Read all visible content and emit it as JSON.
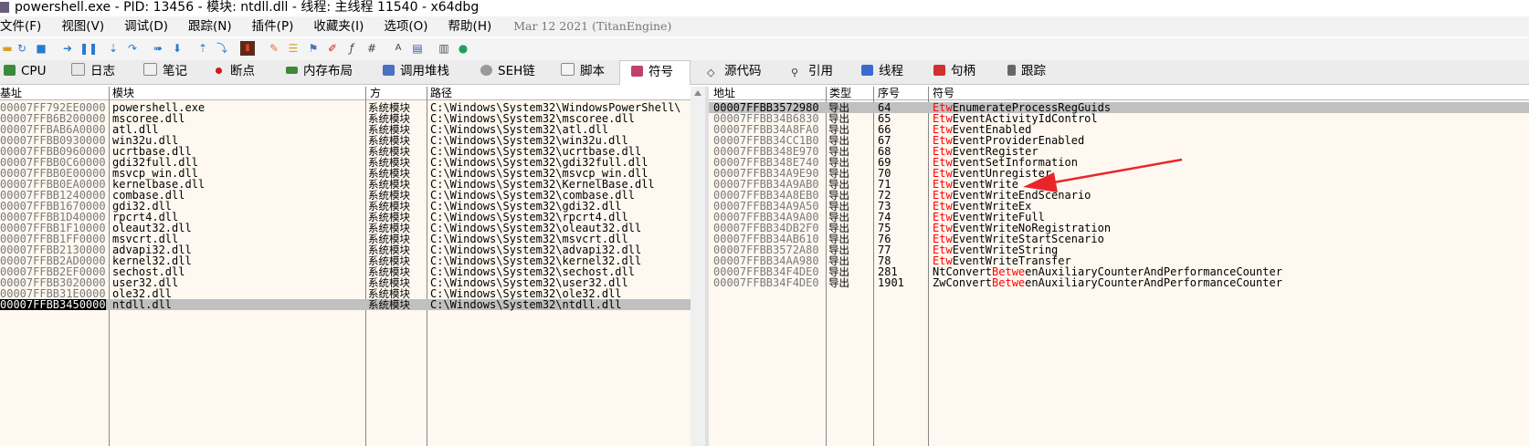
{
  "title": "powershell.exe - PID: 13456 - 模块: ntdll.dll - 线程: 主线程 11540 - x64dbg",
  "menu": [
    "文件(F)",
    "视图(V)",
    "调试(D)",
    "跟踪(N)",
    "插件(P)",
    "收藏夹(I)",
    "选项(O)",
    "帮助(H)"
  ],
  "build_date": "Mar 12 2021 (TitanEngine)",
  "toolbar_icons": [
    "open-icon",
    "restart-icon",
    "stop-icon",
    "run-icon",
    "pause-icon",
    "step-into-icon",
    "step-over-icon",
    "trace-into-icon",
    "trace-over-icon",
    "execute-till-return-icon",
    "run-to-user-icon",
    "trace-icon",
    "patch-icon",
    "comments-icon",
    "labels-icon",
    "bookmarks-icon",
    "functions-icon",
    "variables-icon",
    "font-icon",
    "calculator-icon",
    "scylla-icon",
    "help-icon"
  ],
  "tabs": [
    "CPU",
    "日志",
    "笔记",
    "断点",
    "内存布局",
    "调用堆栈",
    "SEH链",
    "脚本",
    "符号",
    "源代码",
    "引用",
    "线程",
    "句柄",
    "跟踪"
  ],
  "active_tab": "符号",
  "modules": {
    "headers": [
      "基址",
      "模块",
      "方",
      "路径"
    ],
    "rows": [
      {
        "base": "00007FF792EE0000",
        "name": "powershell.exe",
        "party": "系统模块",
        "path": "C:\\Windows\\System32\\WindowsPowerShell\\"
      },
      {
        "base": "00007FFB6B200000",
        "name": "mscoree.dll",
        "party": "系统模块",
        "path": "C:\\Windows\\System32\\mscoree.dll"
      },
      {
        "base": "00007FFBAB6A0000",
        "name": "atl.dll",
        "party": "系统模块",
        "path": "C:\\Windows\\System32\\atl.dll"
      },
      {
        "base": "00007FFBB0930000",
        "name": "win32u.dll",
        "party": "系统模块",
        "path": "C:\\Windows\\System32\\win32u.dll"
      },
      {
        "base": "00007FFBB0960000",
        "name": "ucrtbase.dll",
        "party": "系统模块",
        "path": "C:\\Windows\\System32\\ucrtbase.dll"
      },
      {
        "base": "00007FFBB0C60000",
        "name": "gdi32full.dll",
        "party": "系统模块",
        "path": "C:\\Windows\\System32\\gdi32full.dll"
      },
      {
        "base": "00007FFBB0E00000",
        "name": "msvcp_win.dll",
        "party": "系统模块",
        "path": "C:\\Windows\\System32\\msvcp_win.dll"
      },
      {
        "base": "00007FFBB0EA0000",
        "name": "kernelbase.dll",
        "party": "系统模块",
        "path": "C:\\Windows\\System32\\KernelBase.dll"
      },
      {
        "base": "00007FFBB1240000",
        "name": "combase.dll",
        "party": "系统模块",
        "path": "C:\\Windows\\System32\\combase.dll"
      },
      {
        "base": "00007FFBB1670000",
        "name": "gdi32.dll",
        "party": "系统模块",
        "path": "C:\\Windows\\System32\\gdi32.dll"
      },
      {
        "base": "00007FFBB1D40000",
        "name": "rpcrt4.dll",
        "party": "系统模块",
        "path": "C:\\Windows\\System32\\rpcrt4.dll"
      },
      {
        "base": "00007FFBB1F10000",
        "name": "oleaut32.dll",
        "party": "系统模块",
        "path": "C:\\Windows\\System32\\oleaut32.dll"
      },
      {
        "base": "00007FFBB1FF0000",
        "name": "msvcrt.dll",
        "party": "系统模块",
        "path": "C:\\Windows\\System32\\msvcrt.dll"
      },
      {
        "base": "00007FFBB2130000",
        "name": "advapi32.dll",
        "party": "系统模块",
        "path": "C:\\Windows\\System32\\advapi32.dll"
      },
      {
        "base": "00007FFBB2AD0000",
        "name": "kernel32.dll",
        "party": "系统模块",
        "path": "C:\\Windows\\System32\\kernel32.dll"
      },
      {
        "base": "00007FFBB2EF0000",
        "name": "sechost.dll",
        "party": "系统模块",
        "path": "C:\\Windows\\System32\\sechost.dll"
      },
      {
        "base": "00007FFBB3020000",
        "name": "user32.dll",
        "party": "系统模块",
        "path": "C:\\Windows\\System32\\user32.dll"
      },
      {
        "base": "00007FFBB31E0000",
        "name": "ole32.dll",
        "party": "系统模块",
        "path": "C:\\Windows\\System32\\ole32.dll"
      },
      {
        "base": "00007FFBB3450000",
        "name": "ntdll.dll",
        "party": "系统模块",
        "path": "C:\\Windows\\System32\\ntdll.dll"
      }
    ],
    "selected_index": 18
  },
  "symbols": {
    "headers": [
      "地址",
      "类型",
      "序号",
      "符号"
    ],
    "type_label": "导出",
    "rows": [
      {
        "addr": "00007FFBB3572980",
        "ord": "64",
        "pre": "",
        "hl": "Etw",
        "post": "EnumerateProcessRegGuids"
      },
      {
        "addr": "00007FFBB34B6830",
        "ord": "65",
        "pre": "",
        "hl": "Etw",
        "post": "EventActivityIdControl"
      },
      {
        "addr": "00007FFBB34A8FA0",
        "ord": "66",
        "pre": "",
        "hl": "Etw",
        "post": "EventEnabled"
      },
      {
        "addr": "00007FFBB34CC1B0",
        "ord": "67",
        "pre": "",
        "hl": "Etw",
        "post": "EventProviderEnabled"
      },
      {
        "addr": "00007FFBB348E970",
        "ord": "68",
        "pre": "",
        "hl": "Etw",
        "post": "EventRegister"
      },
      {
        "addr": "00007FFBB348E740",
        "ord": "69",
        "pre": "",
        "hl": "Etw",
        "post": "EventSetInformation"
      },
      {
        "addr": "00007FFBB34A9E90",
        "ord": "70",
        "pre": "",
        "hl": "Etw",
        "post": "EventUnregister"
      },
      {
        "addr": "00007FFBB34A9AB0",
        "ord": "71",
        "pre": "",
        "hl": "Etw",
        "post": "EventWrite"
      },
      {
        "addr": "00007FFBB34A8EB0",
        "ord": "72",
        "pre": "",
        "hl": "Etw",
        "post": "EventWriteEndScenario"
      },
      {
        "addr": "00007FFBB34A9A50",
        "ord": "73",
        "pre": "",
        "hl": "Etw",
        "post": "EventWriteEx"
      },
      {
        "addr": "00007FFBB34A9A00",
        "ord": "74",
        "pre": "",
        "hl": "Etw",
        "post": "EventWriteFull"
      },
      {
        "addr": "00007FFBB34DB2F0",
        "ord": "75",
        "pre": "",
        "hl": "Etw",
        "post": "EventWriteNoRegistration"
      },
      {
        "addr": "00007FFBB34AB610",
        "ord": "76",
        "pre": "",
        "hl": "Etw",
        "post": "EventWriteStartScenario"
      },
      {
        "addr": "00007FFBB3572A80",
        "ord": "77",
        "pre": "",
        "hl": "Etw",
        "post": "EventWriteString"
      },
      {
        "addr": "00007FFBB34AA980",
        "ord": "78",
        "pre": "",
        "hl": "Etw",
        "post": "EventWriteTransfer"
      },
      {
        "addr": "00007FFBB34F4DE0",
        "ord": "281",
        "pre": "NtConvert",
        "hl": "Betwe",
        "post": "enAuxiliaryCounterAndPerformanceCounter"
      },
      {
        "addr": "00007FFBB34F4DE0",
        "ord": "1901",
        "pre": "ZwConvert",
        "hl": "Betwe",
        "post": "enAuxiliaryCounterAndPerformanceCounter"
      }
    ],
    "selected_index": 0
  },
  "colors": {
    "highlight": "#ff0000",
    "arrow": "#e8262a",
    "pane_bg": "#fff8f0",
    "selection": "#c0c0c0"
  }
}
